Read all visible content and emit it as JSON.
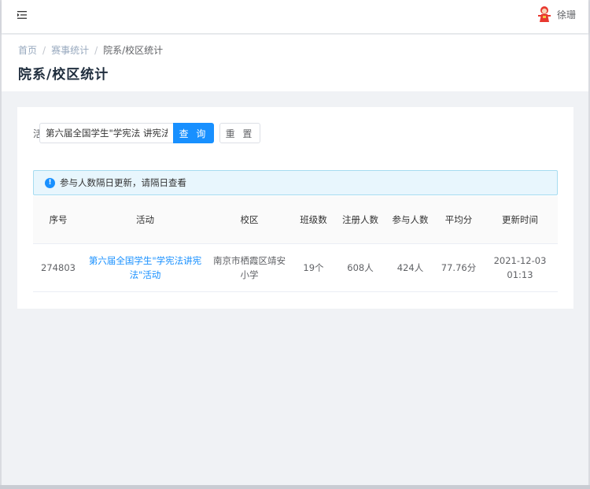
{
  "header": {
    "user_name": "徐珊"
  },
  "breadcrumb": [
    "首页",
    "赛事统计",
    "院系/校区统计"
  ],
  "page_title": "院系/校区统计",
  "search": {
    "label": "活动",
    "value": "第六届全国学生\"学宪法 讲宪法\"活动",
    "query_label": "查 询",
    "reset_label": "重 置"
  },
  "alert": {
    "text": "参与人数隔日更新，请隔日查看"
  },
  "table": {
    "columns": [
      "序号",
      "活动",
      "校区",
      "班级数",
      "注册人数",
      "参与人数",
      "平均分",
      "更新时间"
    ],
    "rows": [
      {
        "id": "274803",
        "activity": "第六届全国学生\"学宪法讲宪法\"活动",
        "campus": "南京市栖霞区靖安小学",
        "classes": "19个",
        "registered": "608人",
        "participants": "424人",
        "avg_score": "77.76分",
        "updated": "2021-12-03 01:13"
      }
    ]
  },
  "colors": {
    "primary": "#1890ff",
    "alert_bg": "#e8f6fd",
    "page_bg": "#f0f2f5"
  }
}
